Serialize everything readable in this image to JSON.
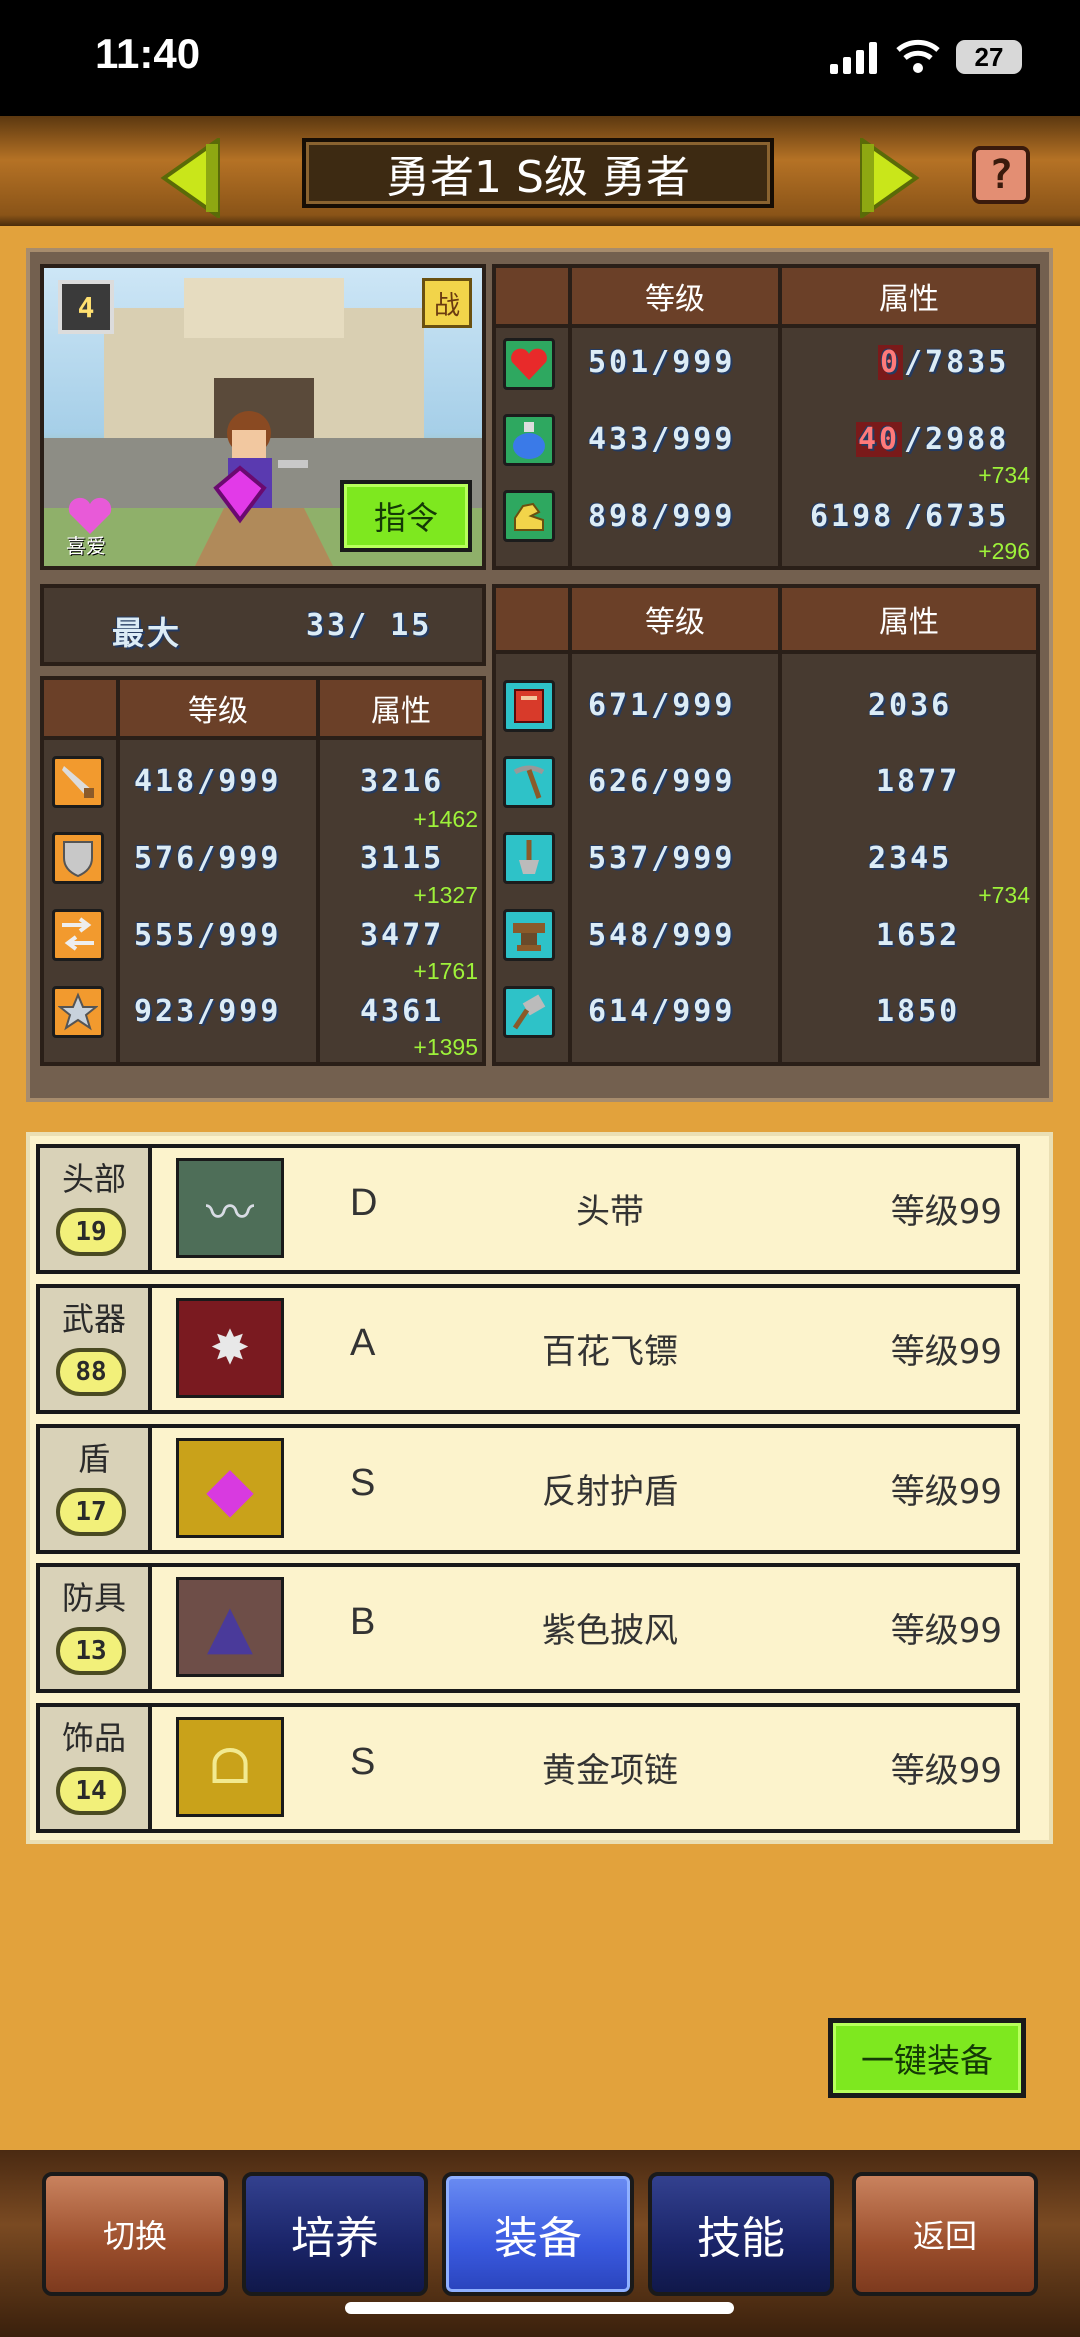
{
  "status_bar": {
    "time": "11:40",
    "battery": "27"
  },
  "header": {
    "title": "勇者1 S级 勇者",
    "help_label": "?"
  },
  "hero": {
    "level_badge": "4",
    "battle_badge": "战",
    "favorite_label": "喜爱",
    "command_label": "指令",
    "max_label": "最大",
    "max_value": "33/ 15"
  },
  "vitals": {
    "headers": {
      "level": "等级",
      "attr": "属性"
    },
    "rows": [
      {
        "icon": "heart-icon",
        "level": "501/999",
        "attr_current": "0",
        "attr_max": "/7835",
        "bonus": ""
      },
      {
        "icon": "potion-icon",
        "level": "433/999",
        "attr_current": "40",
        "attr_max": "/2988",
        "bonus": "+734"
      },
      {
        "icon": "strength-icon",
        "level": "898/999",
        "attr_current": "6198",
        "attr_max": "/6735",
        "bonus": "+296"
      }
    ]
  },
  "combat": {
    "headers": {
      "level": "等级",
      "attr": "属性"
    },
    "rows": [
      {
        "icon": "sword-icon",
        "level": "418/999",
        "attr": "3216",
        "bonus": "+1462"
      },
      {
        "icon": "shield-icon",
        "level": "576/999",
        "attr": "3115",
        "bonus": "+1327"
      },
      {
        "icon": "arrows-icon",
        "level": "555/999",
        "attr": "3477",
        "bonus": "+1761"
      },
      {
        "icon": "star-icon",
        "level": "923/999",
        "attr": "4361",
        "bonus": "+1395"
      }
    ]
  },
  "crafting": {
    "headers": {
      "level": "等级",
      "attr": "属性"
    },
    "rows": [
      {
        "icon": "book-icon",
        "level": "671/999",
        "attr": "2036",
        "bonus": ""
      },
      {
        "icon": "pickaxe-icon",
        "level": "626/999",
        "attr": "1877",
        "bonus": ""
      },
      {
        "icon": "shovel-icon",
        "level": "537/999",
        "attr": "2345",
        "bonus": "+734"
      },
      {
        "icon": "anvil-icon",
        "level": "548/999",
        "attr": "1652",
        "bonus": ""
      },
      {
        "icon": "hammer-icon",
        "level": "614/999",
        "attr": "1850",
        "bonus": ""
      }
    ]
  },
  "equipment": [
    {
      "slot": "头部",
      "slot_level": "19",
      "rank": "D",
      "name": "头带",
      "level": "等级99",
      "icon": "headband-icon",
      "bg": "#4e6e58",
      "glyph": "〰"
    },
    {
      "slot": "武器",
      "slot_level": "88",
      "rank": "A",
      "name": "百花飞镖",
      "level": "等级99",
      "icon": "shuriken-icon",
      "bg": "#7a1a20",
      "glyph": "✸"
    },
    {
      "slot": "盾",
      "slot_level": "17",
      "rank": "S",
      "name": "反射护盾",
      "level": "等级99",
      "icon": "gem-shield-icon",
      "bg": "#c9a21a",
      "glyph": "◆"
    },
    {
      "slot": "防具",
      "slot_level": "13",
      "rank": "B",
      "name": "紫色披风",
      "level": "等级99",
      "icon": "cloak-icon",
      "bg": "#6e4e48",
      "glyph": "▲"
    },
    {
      "slot": "饰品",
      "slot_level": "14",
      "rank": "S",
      "name": "黄金项链",
      "level": "等级99",
      "icon": "necklace-icon",
      "bg": "#c9a21a",
      "glyph": "ᗝ"
    }
  ],
  "auto_equip_label": "一键装备",
  "nav": {
    "switch": "切换",
    "train": "培养",
    "equip": "装备",
    "skill": "技能",
    "back": "返回"
  }
}
